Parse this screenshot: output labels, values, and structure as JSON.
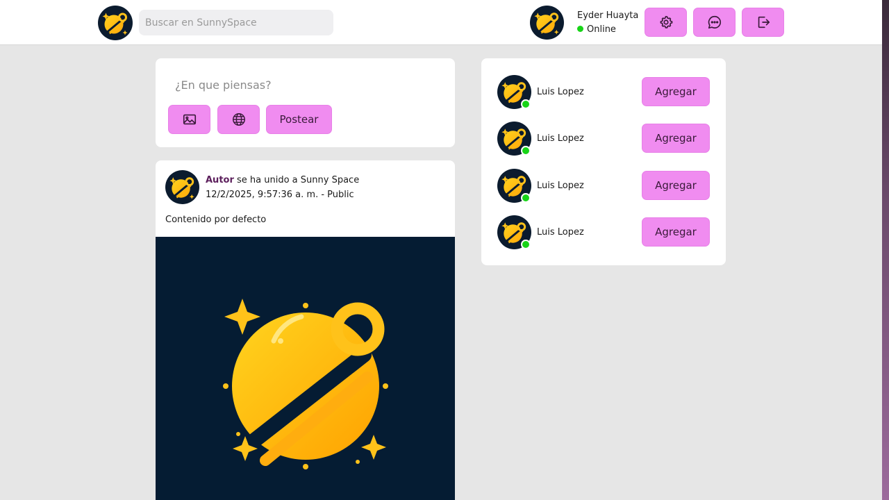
{
  "header": {
    "search_placeholder": "Buscar en SunnySpace",
    "user": {
      "name": "Eyder Huayta",
      "status": "Online"
    },
    "buttons": [
      {
        "icon": "gear-icon"
      },
      {
        "icon": "chat-bubble-icon"
      },
      {
        "icon": "logout-icon"
      }
    ]
  },
  "composer": {
    "placeholder": "¿En que piensas?",
    "image_icon": "image-icon",
    "globe_icon": "globe-icon",
    "post_label": "Postear"
  },
  "post": {
    "author": "Autor",
    "action_text": " se ha unido a Sunny Space",
    "meta": "12/2/2025, 9:57:36 a. m. - Public",
    "content": "Contenido por defecto"
  },
  "friend_suggestions": [
    {
      "name": "Luis Lopez",
      "add_label": "Agregar"
    },
    {
      "name": "Luis Lopez",
      "add_label": "Agregar"
    },
    {
      "name": "Luis Lopez",
      "add_label": "Agregar"
    },
    {
      "name": "Luis Lopez",
      "add_label": "Agregar"
    }
  ],
  "colors": {
    "accent": "#f08cf0",
    "online": "#17d417",
    "logo_bg": "#0b1b2e",
    "author": "#5c1f5c"
  }
}
